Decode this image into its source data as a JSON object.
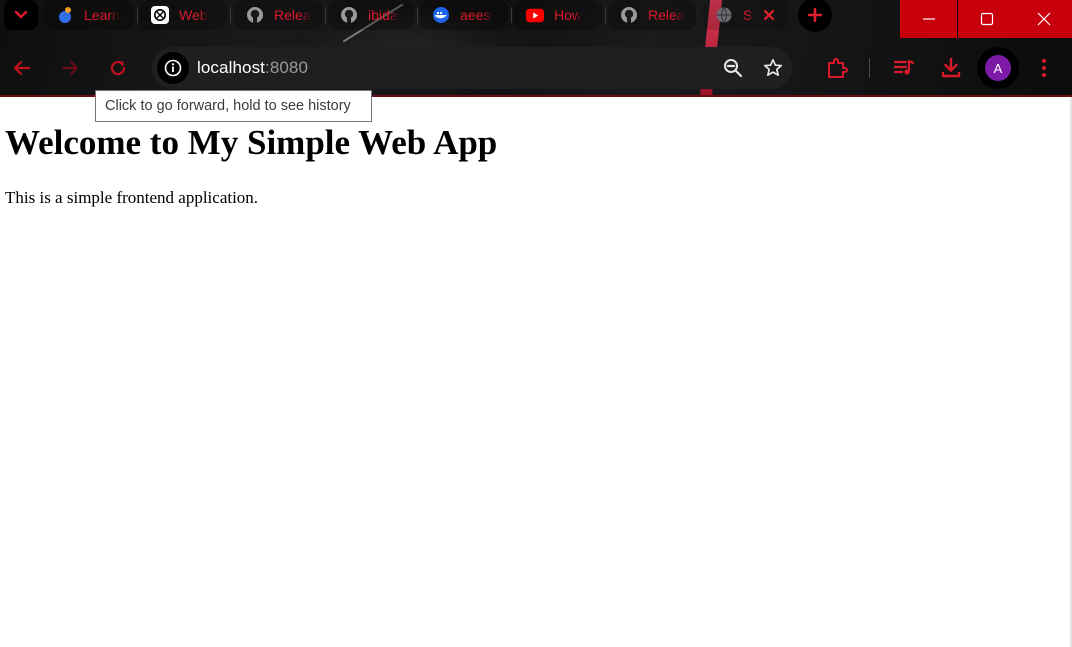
{
  "browser": {
    "tabs": [
      {
        "label": "Learn",
        "icon": "app-icon"
      },
      {
        "label": "Web",
        "icon": "chatgpt-icon"
      },
      {
        "label": "Relea",
        "icon": "github-icon"
      },
      {
        "label": "ibida",
        "icon": "github-icon"
      },
      {
        "label": "aeesl",
        "icon": "docker-icon"
      },
      {
        "label": "How",
        "icon": "youtube-icon"
      },
      {
        "label": "Relea",
        "icon": "github-icon"
      },
      {
        "label": "S",
        "icon": "globe-icon"
      }
    ],
    "address_bar": {
      "host": "localhost",
      "port": ":8080"
    },
    "profile_initial": "A",
    "accent_color": "#d91a2a",
    "window_button_color": "#c8000b"
  },
  "tooltip": {
    "text": "Click to go forward, hold to see history"
  },
  "page": {
    "heading": "Welcome to My Simple Web App",
    "paragraph": "This is a simple frontend application."
  }
}
